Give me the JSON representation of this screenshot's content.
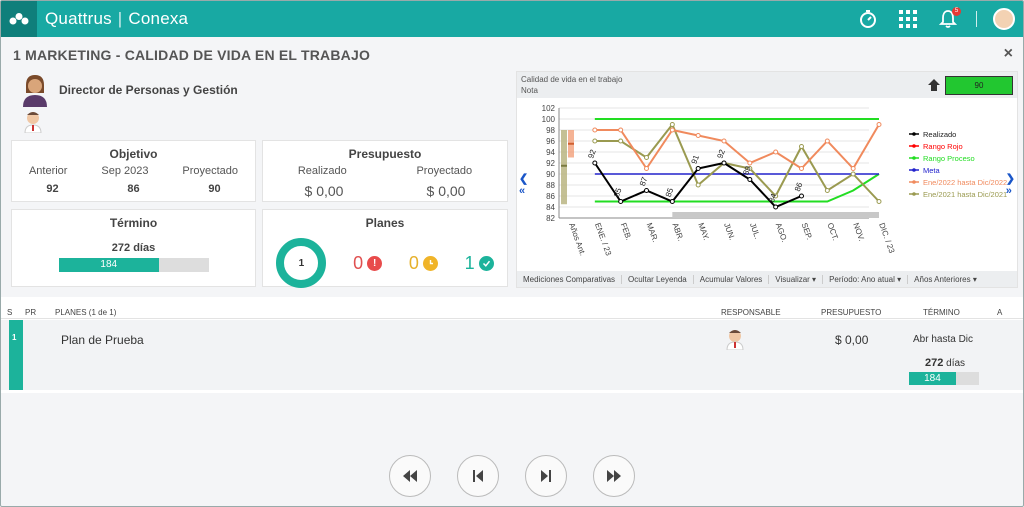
{
  "app": {
    "brand": "Quattrus",
    "product": "Conexa",
    "notification_count": "5"
  },
  "header": {
    "title": "1 MARKETING - CALIDAD DE VIDA EN EL TRABAJO",
    "close_label": "×"
  },
  "person": {
    "name": "Director de Personas y Gestión"
  },
  "objetivo": {
    "title": "Objetivo",
    "columns": [
      "Anterior",
      "Sep 2023",
      "Proyectado"
    ],
    "values": [
      "92",
      "86",
      "90"
    ]
  },
  "presupuesto": {
    "title": "Presupuesto",
    "columns": [
      "Realizado",
      "Proyectado"
    ],
    "values": [
      "$ 0,00",
      "$ 0,00"
    ]
  },
  "termino": {
    "title": "Término",
    "days_label": "272 días",
    "bar_value": "184",
    "progress_fraction": 0.67
  },
  "planes": {
    "title": "Planes",
    "total": "1",
    "overdue": "0",
    "pending": "0",
    "done": "1"
  },
  "chart_header": {
    "title": "Calidad de vida en el trabajo",
    "subtitle": "Nota",
    "gauge_value": "90"
  },
  "chart_toolbar": [
    "Mediciones Comparativas",
    "Ocultar Leyenda",
    "Acumular Valores",
    "Visualizar ▾",
    "Período: Ano atual ▾",
    "Años Anteriores ▾"
  ],
  "chart_data": {
    "type": "line",
    "categories": [
      "Años Ant.",
      "ENE. / 23",
      "FEB.",
      "MAR.",
      "ABR.",
      "MAY.",
      "JUN.",
      "JUL.",
      "AGO.",
      "SEP.",
      "OCT.",
      "NOV.",
      "DIC. / 23"
    ],
    "ylim": [
      82,
      102
    ],
    "yticks": [
      82,
      84,
      86,
      88,
      90,
      92,
      94,
      96,
      98,
      100,
      102
    ],
    "series": [
      {
        "name": "Realizado",
        "color": "#000000",
        "values": [
          null,
          92,
          85,
          87,
          85,
          91,
          92,
          89,
          84,
          86,
          null,
          null,
          null
        ]
      },
      {
        "name": "Rango Rojo",
        "color": "#ff0000",
        "values": []
      },
      {
        "name": "Rango Proceso",
        "color": "#22dd22",
        "values": [
          null,
          100,
          100,
          100,
          100,
          100,
          100,
          100,
          100,
          100,
          100,
          100,
          100
        ]
      },
      {
        "name": "Meta",
        "color": "#2222cc",
        "values": [
          null,
          90,
          90,
          90,
          90,
          90,
          90,
          90,
          90,
          90,
          90,
          90,
          90
        ]
      },
      {
        "name": "Ene/2022 hasta Dic/2022",
        "color": "#f08a5d",
        "values": [
          null,
          98,
          98,
          91,
          98,
          97,
          96,
          92,
          94,
          91,
          96,
          91,
          99
        ]
      },
      {
        "name": "Ene/2021 hasta Dic/2021",
        "color": "#9a9a50",
        "values": [
          null,
          96,
          96,
          93,
          99,
          88,
          92,
          91,
          86,
          95,
          87,
          90,
          85
        ]
      }
    ],
    "green_line_lower": [
      null,
      85,
      85,
      85,
      85,
      85,
      85,
      85,
      85,
      85,
      85,
      87,
      90
    ],
    "data_labels": [
      "92",
      "85",
      "87",
      "85",
      "91",
      "92",
      "89",
      "84",
      "86"
    ]
  },
  "table": {
    "headers": {
      "s": "S",
      "pr": "PR",
      "planes": "PLANES (1 de 1)",
      "responsable": "RESPONSABLE",
      "presupuesto": "PRESUPUESTO",
      "termino": "TÉRMINO",
      "a": "A"
    },
    "row": {
      "index": "1",
      "name": "Plan de Prueba",
      "budget": "$ 0,00",
      "term": "Abr hasta Dic",
      "days": "272",
      "days_unit": "días",
      "bar_value": "184",
      "progress_fraction": 0.67
    }
  },
  "icons": [
    "app-logo-icon",
    "stopwatch-icon",
    "grid-apps-icon",
    "bell-icon",
    "user-avatar",
    "home-icon",
    "first-page-icon",
    "prev-page-icon",
    "next-page-icon",
    "last-page-icon"
  ]
}
